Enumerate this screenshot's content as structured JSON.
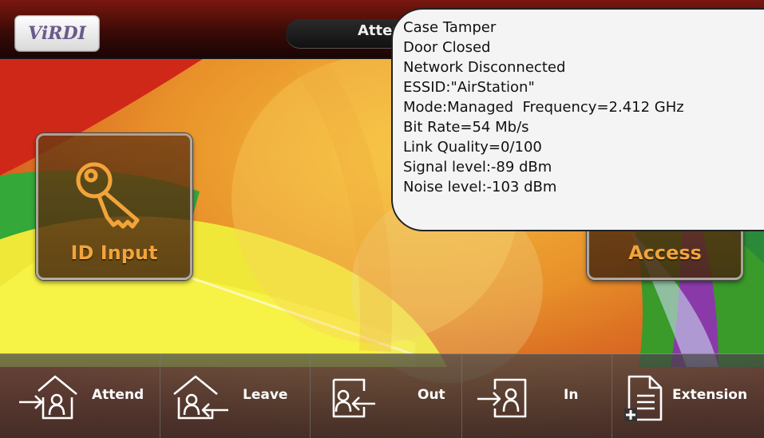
{
  "header": {
    "logo_text": "ViRDI",
    "mode_label": "Attend",
    "status_icons": [
      "wifi-icon",
      "warning-icon",
      "person-icon",
      "door-icon",
      "lock-icon"
    ]
  },
  "main": {
    "id_input_label": "ID Input",
    "access_label": "Access"
  },
  "toolbar": {
    "items": [
      {
        "label": "Attend",
        "icon": "attend-icon"
      },
      {
        "label": "Leave",
        "icon": "leave-icon"
      },
      {
        "label": "Out",
        "icon": "out-icon"
      },
      {
        "label": "In",
        "icon": "in-icon"
      },
      {
        "label": "Extension",
        "icon": "extension-icon"
      }
    ]
  },
  "popup": {
    "lines": [
      "Case Tamper",
      "Door Closed",
      "Network Disconnected",
      "ESSID:\"AirStation\"",
      "Mode:Managed  Frequency=2.412 GHz",
      "Bit Rate=54 Mb/s",
      "Link Quality=0/100",
      "Signal level:-89 dBm",
      "Noise level:-103 dBm"
    ]
  },
  "colors": {
    "accent_orange": "#f2a43a",
    "topbar": "#5a120c"
  }
}
